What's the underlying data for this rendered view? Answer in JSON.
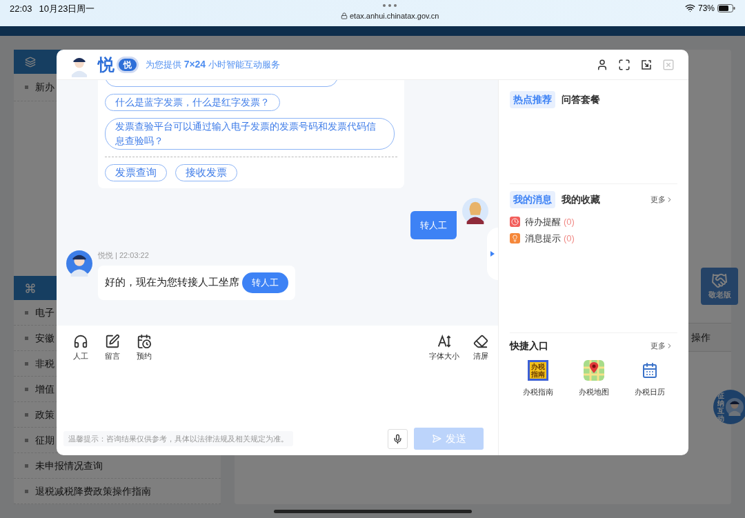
{
  "status_bar": {
    "time": "22:03",
    "date": "10月23日周一",
    "url": "etax.anhui.chinatax.gov.cn",
    "battery": "73%"
  },
  "background": {
    "sidebar_sections": [
      {
        "items": [
          "新办"
        ]
      },
      {
        "items": [
          "电子",
          "安徽",
          "非税",
          "增值",
          "政策",
          "征期",
          "未申报情况查询",
          "退税减税降费政策操作指南"
        ]
      }
    ],
    "table_header": "操作",
    "elder_button": "敬老版",
    "floating_assistant": "征纳互动"
  },
  "chat_window": {
    "brand": "悦",
    "badge": "悦",
    "subtitle": "为您提供 **7×24** 小时智能互动服务",
    "questions": [
      "什么是蓝字发票，什么是红字发票？",
      "发票查验平台可以通过输入电子发票的发票号码和发票代码信息查验吗？"
    ],
    "quick_actions": [
      "发票查询",
      "接收发票"
    ],
    "messages": [
      {
        "kind": "user",
        "text": "转人工"
      },
      {
        "kind": "bot",
        "meta": "悦悦 | 22:03:22",
        "text": "好的，现在为您转接人工坐席",
        "action": "转人工"
      }
    ],
    "left_tools": [
      {
        "kind": "headset",
        "label": "人工"
      },
      {
        "kind": "note",
        "label": "留言"
      },
      {
        "kind": "calendar",
        "label": "预约"
      }
    ],
    "right_tools": [
      {
        "kind": "font",
        "label": "字体大小"
      },
      {
        "kind": "eraser",
        "label": "清屏"
      }
    ],
    "tip": "温馨提示：咨询结果仅供参考，具体以法律法规及相关规定为准。",
    "send": {
      "label": "发送",
      "disabled": true
    },
    "hot_tabs": [
      {
        "label": "热点推荐",
        "selected": true
      },
      {
        "label": "问答套餐",
        "selected": false
      }
    ],
    "message_tabs": [
      {
        "label": "我的消息",
        "selected": true
      },
      {
        "label": "我的收藏",
        "selected": false
      }
    ],
    "message_more": "更多",
    "message_items": [
      {
        "kind": "clock",
        "label": "待办提醒",
        "count": "(0)",
        "color": "#f25f5c"
      },
      {
        "kind": "bulb",
        "label": "消息提示",
        "count": "(0)",
        "color": "#f5873a"
      }
    ],
    "shortcuts_title": "快捷入口",
    "shortcuts_more": "更多",
    "shortcuts": [
      {
        "kind": "guide",
        "label": "办税指南",
        "icon_text": [
          "办税",
          "指南"
        ]
      },
      {
        "kind": "map",
        "label": "办税地图"
      },
      {
        "kind": "calendar",
        "label": "办税日历"
      }
    ]
  }
}
